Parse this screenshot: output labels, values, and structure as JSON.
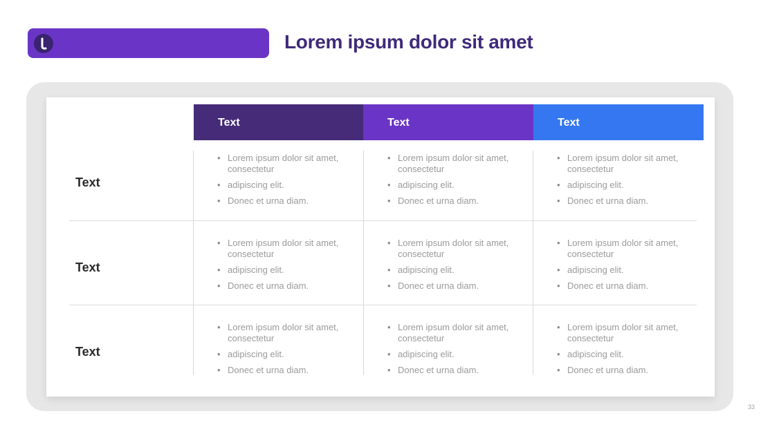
{
  "brand": {
    "logo_icon": "brand-logo-icon"
  },
  "title": "Lorem ipsum dolor sit amet",
  "columns": [
    {
      "label": "Text",
      "color": "#452b78"
    },
    {
      "label": "Text",
      "color": "#6a35c6"
    },
    {
      "label": "Text",
      "color": "#3577f0"
    }
  ],
  "rows": [
    {
      "label": "Text",
      "cells": [
        [
          "Lorem ipsum dolor sit amet, consectetur",
          "adipiscing elit.",
          "Donec et urna diam."
        ],
        [
          "Lorem ipsum dolor sit amet, consectetur",
          "adipiscing elit.",
          "Donec et urna diam."
        ],
        [
          "Lorem ipsum dolor sit amet, consectetur",
          "adipiscing elit.",
          "Donec et urna diam."
        ]
      ]
    },
    {
      "label": "Text",
      "cells": [
        [
          "Lorem ipsum dolor sit amet, consectetur",
          "adipiscing elit.",
          "Donec et urna diam."
        ],
        [
          "Lorem ipsum dolor sit amet, consectetur",
          "adipiscing elit.",
          "Donec et urna diam."
        ],
        [
          "Lorem ipsum dolor sit amet, consectetur",
          "adipiscing elit.",
          "Donec et urna diam."
        ]
      ]
    },
    {
      "label": "Text",
      "cells": [
        [
          "Lorem ipsum dolor sit amet, consectetur",
          "adipiscing elit.",
          "Donec et urna diam."
        ],
        [
          "Lorem ipsum dolor sit amet, consectetur",
          "adipiscing elit.",
          "Donec et urna diam."
        ],
        [
          "Lorem ipsum dolor sit amet, consectetur",
          "adipiscing elit.",
          "Donec et urna diam."
        ]
      ]
    }
  ],
  "page_number": "33"
}
